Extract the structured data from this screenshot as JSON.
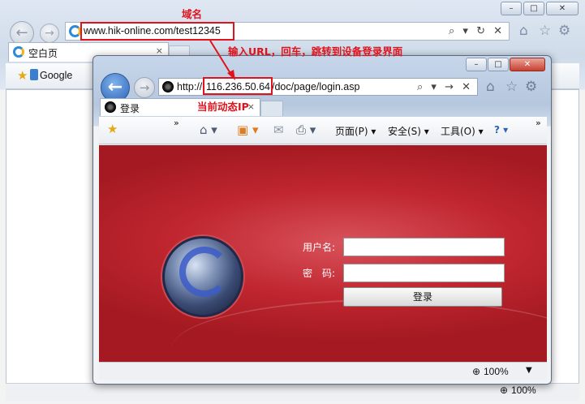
{
  "back_browser": {
    "address_url": "www.hik-online.com/test12345",
    "tab_label": "空白页",
    "tab_close": "×",
    "favorites_google": "Google",
    "window_controls": {
      "minimize": "–",
      "maximize": "□",
      "close": "✕"
    },
    "nav": {
      "back": "←",
      "forward": "→"
    },
    "address_tools": "⌕ ▾ ↻ ✕",
    "zoom": "100%"
  },
  "front_browser": {
    "address_url_prefix": "http://",
    "address_url_ip": "116.236.50.64",
    "address_url_path": "/doc/page/login.asp",
    "address_tools": "⌕ ▾ → ✕",
    "tab_label": "登录",
    "tab_close": "×",
    "window_controls": {
      "minimize": "–",
      "maximize": "□",
      "close": "✕"
    },
    "nav": {
      "back": "←",
      "forward": "→"
    },
    "command_bar": {
      "chevron": "»",
      "page_menu": "页面(P) ▾",
      "safety_menu": "安全(S) ▾",
      "tools_menu": "工具(O) ▾",
      "help_menu": "? ▾"
    },
    "login": {
      "username_label": "用户名:",
      "password_label": "密　码:",
      "username_value": "",
      "password_value": "",
      "login_button": "登录"
    },
    "zoom": "100%"
  },
  "annotations": {
    "domain_label": "域名",
    "arrow_caption": "输入URL，回车，跳转到设备登录界面",
    "dynamic_ip_label": "当前动态IP"
  },
  "colors": {
    "annotation_red": "#e0121c",
    "login_bg_red": "#c0262f",
    "ie_blue": "#2c63b8"
  },
  "icons": [
    "ie-icon",
    "home-icon",
    "star-icon",
    "gear-icon",
    "camera-icon",
    "rss-icon",
    "mail-icon",
    "print-icon",
    "help-icon",
    "zoom-icon",
    "favorites-star-icon"
  ]
}
